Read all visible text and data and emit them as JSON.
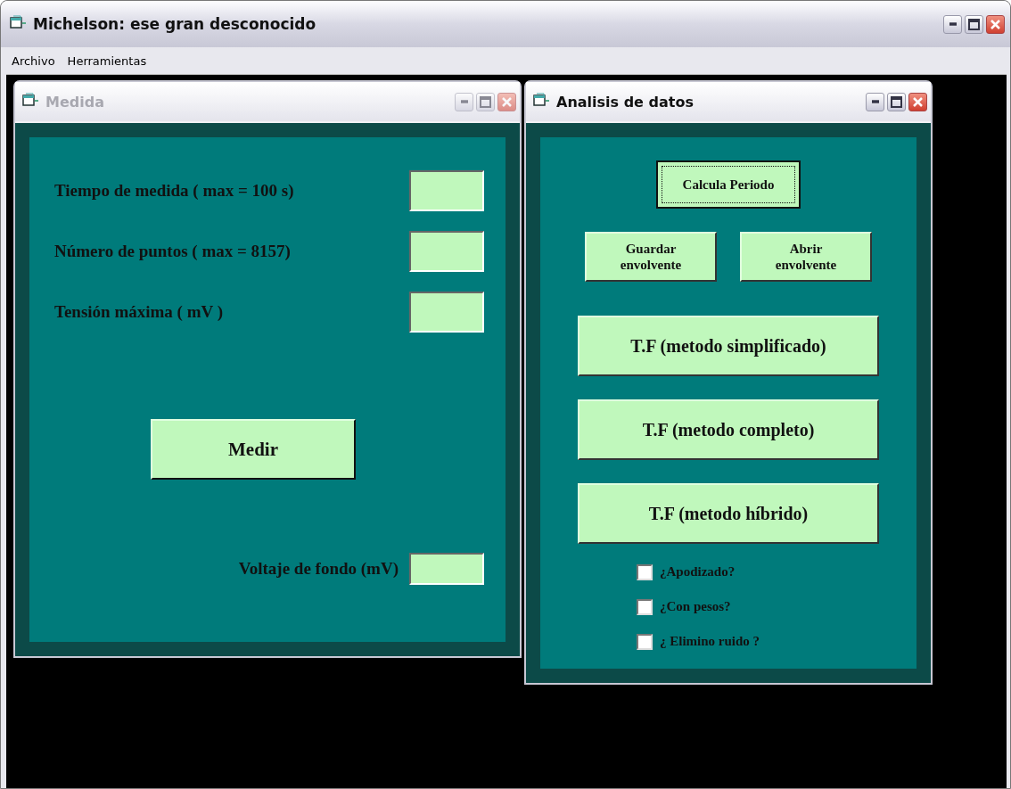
{
  "window": {
    "title": "Michelson: ese gran desconocido"
  },
  "menu": [
    "Archivo",
    "Herramientas"
  ],
  "medida": {
    "title": "Medida",
    "active": false,
    "fields": [
      {
        "label": "Tiempo de medida ( max = 100 s)"
      },
      {
        "label": "Número de puntos ( max = 8157)"
      },
      {
        "label": "Tensión máxima  ( mV )"
      }
    ],
    "button": "Medir",
    "background_field": {
      "label": "Voltaje de fondo (mV)"
    }
  },
  "analisis": {
    "title": "Analisis de datos",
    "active": true,
    "period_button": {
      "label": "Calcula Periodo",
      "focused": true
    },
    "envelope_buttons": [
      {
        "line1": "Guardar",
        "line2": "envolvente"
      },
      {
        "line1": "Abrir",
        "line2": "envolvente"
      }
    ],
    "transform_buttons": [
      "T.F (metodo simplificado)",
      "T.F (metodo completo)",
      "T.F (metodo híbrido)"
    ],
    "options": [
      {
        "label": "¿Apodizado?",
        "checked": false
      },
      {
        "label": "¿Con pesos?",
        "checked": false
      },
      {
        "label": "¿ Elimino ruido ?",
        "checked": false
      }
    ]
  }
}
